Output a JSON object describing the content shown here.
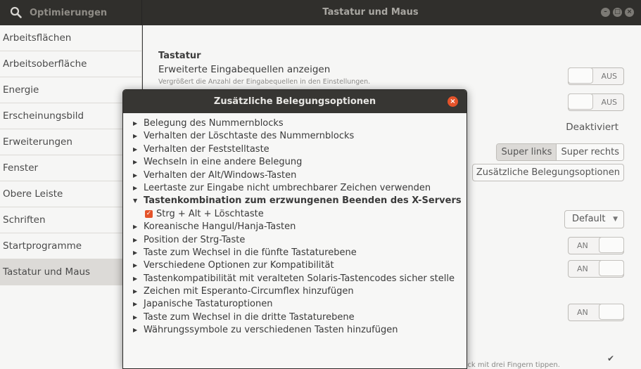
{
  "header": {
    "app_title": "Optimierungen",
    "window_title": "Tastatur und Maus",
    "icons": [
      "search-icon",
      "minimize-icon",
      "maximize-icon",
      "close-icon"
    ]
  },
  "sidebar": {
    "items": [
      {
        "label": "Arbeitsflächen"
      },
      {
        "label": "Arbeitsoberfläche"
      },
      {
        "label": "Energie"
      },
      {
        "label": "Erscheinungsbild"
      },
      {
        "label": "Erweiterungen"
      },
      {
        "label": "Fenster"
      },
      {
        "label": "Obere Leiste"
      },
      {
        "label": "Schriften"
      },
      {
        "label": "Startprogramme"
      },
      {
        "label": "Tastatur und Maus",
        "active": true
      }
    ]
  },
  "main": {
    "section_title": "Tastatur",
    "row1_label": "Erweiterte Eingabequellen anzeigen",
    "row1_desc": "Vergrößert die Anzahl der Eingabequellen in den Einstellungen.",
    "switch_off_label": "AUS",
    "switch_on_label": "AN",
    "deactivated_value": "Deaktiviert",
    "super_left": "Super links",
    "super_right": "Super rechts",
    "extra_options_button": "Zusätzliche Belegungsoptionen",
    "dropdown_value": "Default",
    "bottom_hint": "klick mit drei Fingern tippen.",
    "bottom_check": "✔"
  },
  "dialog": {
    "title": "Zusätzliche Belegungsoptionen",
    "options": [
      {
        "label": "Belegung des Nummernblocks"
      },
      {
        "label": "Verhalten der Löschtaste des Nummernblocks"
      },
      {
        "label": "Verhalten der Feststelltaste"
      },
      {
        "label": "Wechseln in eine andere Belegung"
      },
      {
        "label": "Verhalten der Alt/Windows-Tasten"
      },
      {
        "label": "Leertaste zur Eingabe nicht umbrechbarer Zeichen verwenden"
      },
      {
        "label": "Tastenkombination zum erzwungenen Beenden des X-Servers",
        "expanded": true
      },
      {
        "label": "Koreanische Hangul/Hanja-Tasten"
      },
      {
        "label": "Position der Strg-Taste"
      },
      {
        "label": "Taste zum Wechsel in die fünfte Tastaturebene"
      },
      {
        "label": "Verschiedene Optionen zur Kompatibilität"
      },
      {
        "label": "Tastenkompatibilität mit veralteten Solaris-Tastencodes sicher stelle"
      },
      {
        "label": "Zeichen mit Esperanto-Circumflex hinzufügen"
      },
      {
        "label": "Japanische Tastaturoptionen"
      },
      {
        "label": "Taste zum Wechsel in die dritte Tastaturebene"
      },
      {
        "label": "Währungssymbole zu verschiedenen Tasten hinzufügen"
      }
    ],
    "sub_option": {
      "label": "Strg + Alt + Löschtaste",
      "checked": true
    }
  },
  "colors": {
    "accent": "#e4532a",
    "titlebar": "#302f2c"
  }
}
